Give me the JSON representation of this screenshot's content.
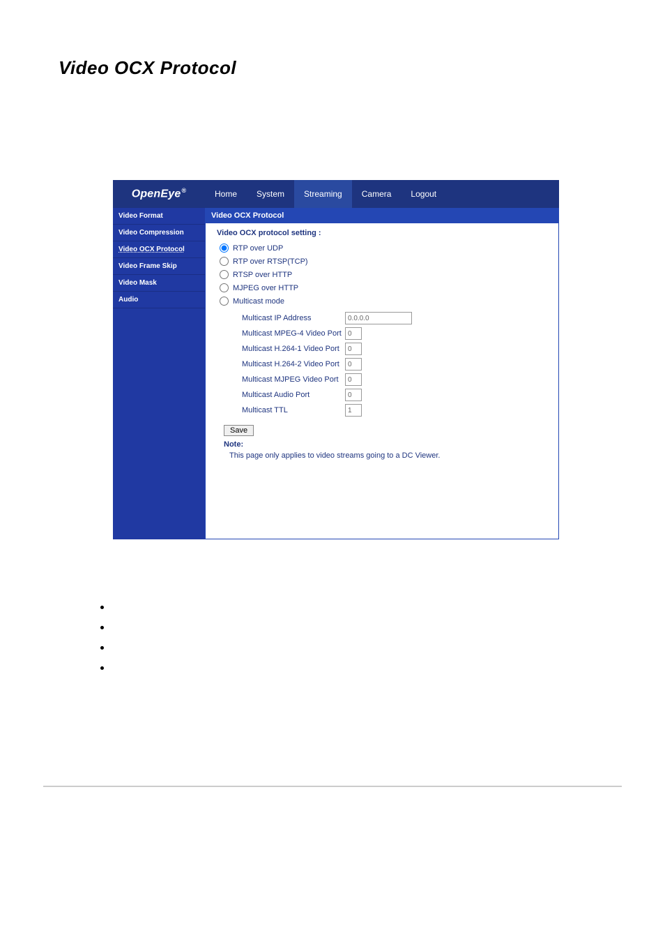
{
  "page_heading": "Video OCX Protocol",
  "brand": "OpenEye",
  "nav_tabs": [
    {
      "label": "Home",
      "active": false
    },
    {
      "label": "System",
      "active": false
    },
    {
      "label": "Streaming",
      "active": true
    },
    {
      "label": "Camera",
      "active": false
    },
    {
      "label": "Logout",
      "active": false
    }
  ],
  "sidebar_items": [
    {
      "label": "Video Format",
      "active": false
    },
    {
      "label": "Video Compression",
      "active": false
    },
    {
      "label": "Video OCX Protocol",
      "active": true
    },
    {
      "label": "Video Frame Skip",
      "active": false
    },
    {
      "label": "Video Mask",
      "active": false
    },
    {
      "label": "Audio",
      "active": false
    }
  ],
  "main_header": "Video OCX Protocol",
  "setting_title": "Video OCX protocol setting :",
  "radios": {
    "rtp_udp": "RTP over UDP",
    "rtp_rtsp_tcp": "RTP over RTSP(TCP)",
    "rtsp_http": "RTSP over HTTP",
    "mjpeg_http": "MJPEG over HTTP",
    "multicast": "Multicast mode"
  },
  "multicast_fields": {
    "ip_label": "Multicast IP Address",
    "ip_value": "0.0.0.0",
    "mpeg4_label": "Multicast MPEG-4 Video Port",
    "mpeg4_value": "0",
    "h264_1_label": "Multicast H.264-1 Video Port",
    "h264_1_value": "0",
    "h264_2_label": "Multicast H.264-2 Video Port",
    "h264_2_value": "0",
    "mjpeg_label": "Multicast MJPEG Video Port",
    "mjpeg_value": "0",
    "audio_label": "Multicast Audio Port",
    "audio_value": "0",
    "ttl_label": "Multicast TTL",
    "ttl_value": "1"
  },
  "save_label": "Save",
  "note_label": "Note:",
  "note_text": "This page only applies to video streams going to a DC Viewer."
}
